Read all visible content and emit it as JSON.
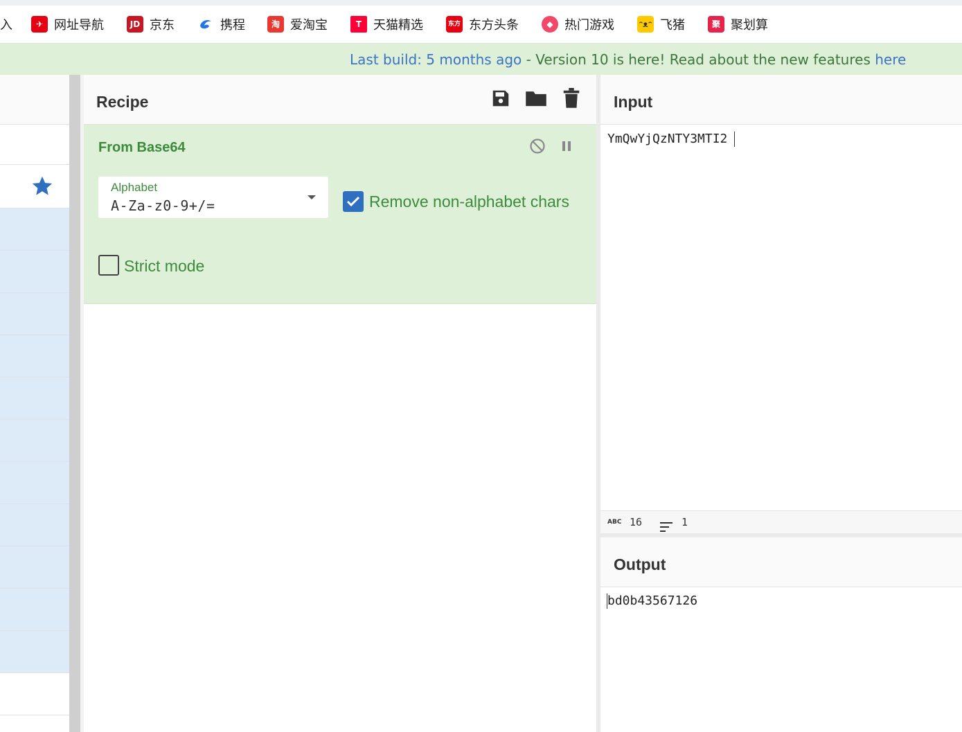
{
  "bookmarks": [
    {
      "label": "入",
      "icon": "partial-icon",
      "color": "#ffffff"
    },
    {
      "label": "网址导航",
      "icon": "nav-icon",
      "color": "#e60012"
    },
    {
      "label": "京东",
      "icon": "jd-icon",
      "color": "#c91623"
    },
    {
      "label": "携程",
      "icon": "ctrip-icon",
      "color": "#2577e3"
    },
    {
      "label": "爱淘宝",
      "icon": "taobao-icon",
      "color": "#e8382f"
    },
    {
      "label": "天猫精选",
      "icon": "tmall-icon",
      "color": "#ff0036"
    },
    {
      "label": "东方头条",
      "icon": "dftt-icon",
      "color": "#e60012"
    },
    {
      "label": "热门游戏",
      "icon": "games-icon",
      "color": "#f2486a"
    },
    {
      "label": "飞猪",
      "icon": "fliggy-icon",
      "color": "#ffc900"
    },
    {
      "label": "聚划算",
      "icon": "juhuasuan-icon",
      "color": "#e6244b"
    }
  ],
  "banner": {
    "last_build": "Last build: 5 months ago",
    "separator": " - ",
    "message": "Version 10 is here! Read about the new features ",
    "link": "here"
  },
  "recipe": {
    "title": "Recipe",
    "operation": {
      "name": "From Base64",
      "alphabet_label": "Alphabet",
      "alphabet_value": "A-Za-z0-9+/=",
      "remove_label": "Remove non-alphabet chars",
      "remove_checked": true,
      "strict_label": "Strict mode",
      "strict_checked": false
    }
  },
  "input": {
    "title": "Input",
    "text": "YmQwYjQzNTY3MTI2",
    "length_label": "ABC",
    "length": "16",
    "lines": "1"
  },
  "output": {
    "title": "Output",
    "text": "bd0b43567126"
  },
  "colors": {
    "banner_bg": "#dff0d8",
    "op_bg": "#dff0d8",
    "op_text": "#3c8b3c",
    "accent_blue": "#2f6fc0",
    "ops_highlight": "#dcebf7"
  }
}
